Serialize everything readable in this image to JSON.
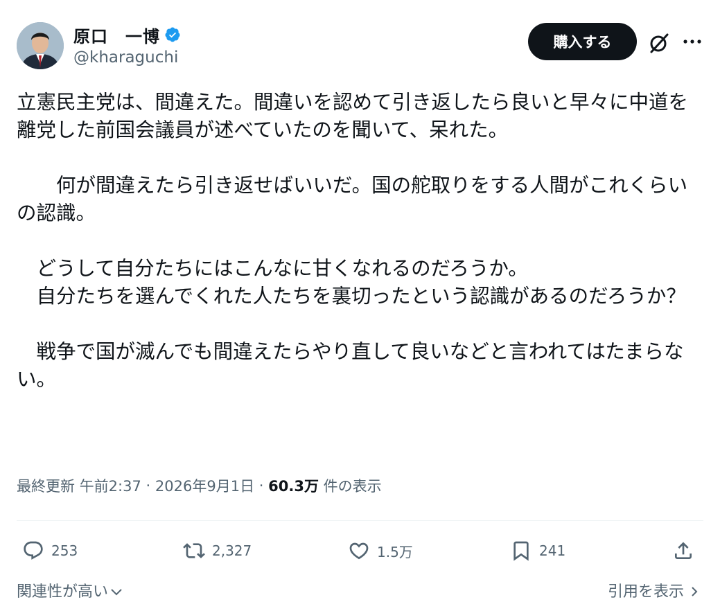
{
  "author": {
    "name": "原口　一博",
    "handle": "@kharaguchi"
  },
  "header": {
    "buy_label": "購入する"
  },
  "post": {
    "text": "立憲民主党は、間違えた。間違いを認めて引き返したら良いと早々に中道を離党した前国会議員が述べていたのを聞いて、呆れた。\n\n　　何が間違えたら引き返せばいいだ。国の舵取りをする人間がこれくらいの認識。\n\n　どうして自分たちにはこんなに甘くなれるのだろうか。\n　自分たちを選んでくれた人たちを裏切ったという認識があるのだろうか？\n\n　戦争で国が滅んでも間違えたらやり直して良いなどと言われてはたまらない。"
  },
  "meta": {
    "updated_label": "最終更新",
    "time": "午前2:37",
    "date": "2026年9月1日",
    "views_count": "60.3万",
    "views_label": "件の表示",
    "separator": "·"
  },
  "actions": {
    "replies": "253",
    "reposts": "2,327",
    "likes": "1.5万",
    "bookmarks": "241"
  },
  "footer": {
    "sort_label": "関連性が高い",
    "quotes_label": "引用を表示"
  },
  "colors": {
    "text": "#0f1419",
    "secondary": "#536471",
    "verified": "#1d9bf0",
    "button_bg": "#0f1419"
  },
  "icons": [
    "verified-badge-icon",
    "grok-icon",
    "more-icon",
    "reply-icon",
    "repost-icon",
    "like-icon",
    "bookmark-icon",
    "share-icon",
    "chevron-down-icon",
    "chevron-right-icon"
  ]
}
